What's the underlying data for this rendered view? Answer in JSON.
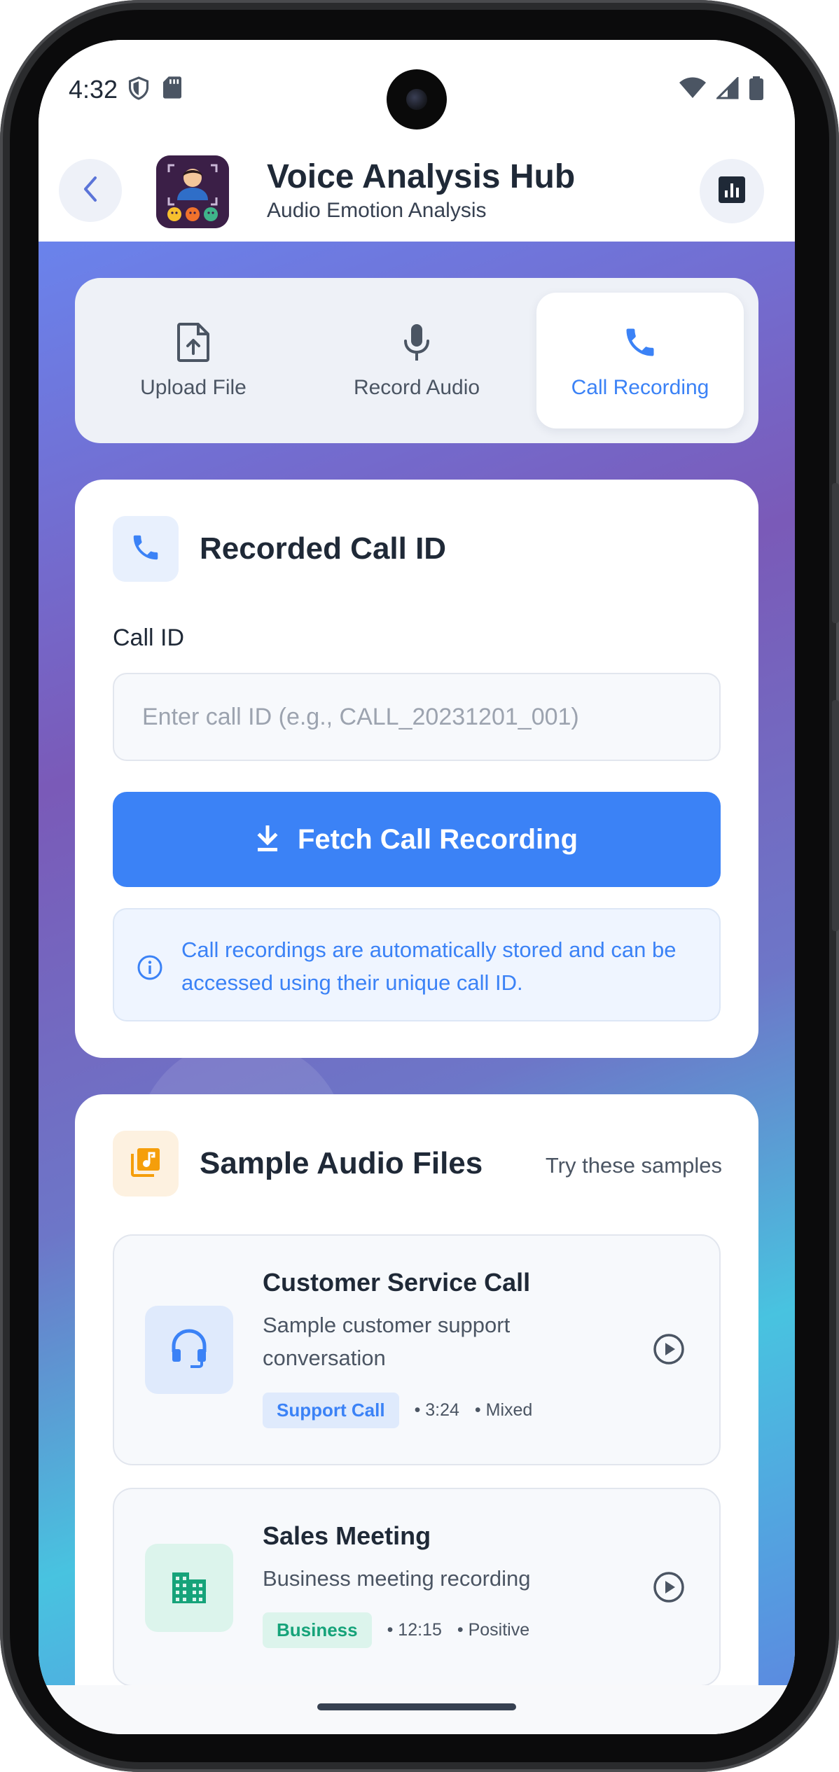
{
  "status_bar": {
    "time": "4:32",
    "left_icons": [
      "shield-icon",
      "sd-card-icon"
    ],
    "right_icons": [
      "wifi-icon",
      "cell-signal-icon",
      "battery-icon"
    ]
  },
  "header": {
    "title": "Voice Analysis Hub",
    "subtitle": "Audio Emotion Analysis",
    "back_icon": "chevron-left-icon",
    "stats_icon": "bar-chart-icon"
  },
  "tabs": [
    {
      "label": "Upload File",
      "icon": "upload-file-icon",
      "active": false
    },
    {
      "label": "Record Audio",
      "icon": "mic-icon",
      "active": false
    },
    {
      "label": "Call Recording",
      "icon": "phone-icon",
      "active": true
    }
  ],
  "call_card": {
    "title": "Recorded Call ID",
    "field_label": "Call ID",
    "input_value": "",
    "input_placeholder": "Enter call ID (e.g., CALL_20231201_001)",
    "fetch_label": "Fetch Call Recording",
    "info_text": "Call recordings are automatically stored and can be accessed using their unique call ID."
  },
  "samples_card": {
    "title": "Sample Audio Files",
    "hint": "Try these samples",
    "items": [
      {
        "title": "Customer Service Call",
        "description": "Sample customer support conversation",
        "badge": "Support Call",
        "duration": "• 3:24",
        "sentiment": "• Mixed",
        "icon": "headset-icon"
      },
      {
        "title": "Sales Meeting",
        "description": "Business meeting recording",
        "badge": "Business",
        "duration": "• 12:15",
        "sentiment": "• Positive",
        "icon": "building-icon"
      }
    ]
  },
  "colors": {
    "accent": "#3b82f6",
    "text_primary": "#1f2937",
    "text_secondary": "#4b5563",
    "business_green": "#16a37a",
    "music_orange": "#f59e0b"
  }
}
